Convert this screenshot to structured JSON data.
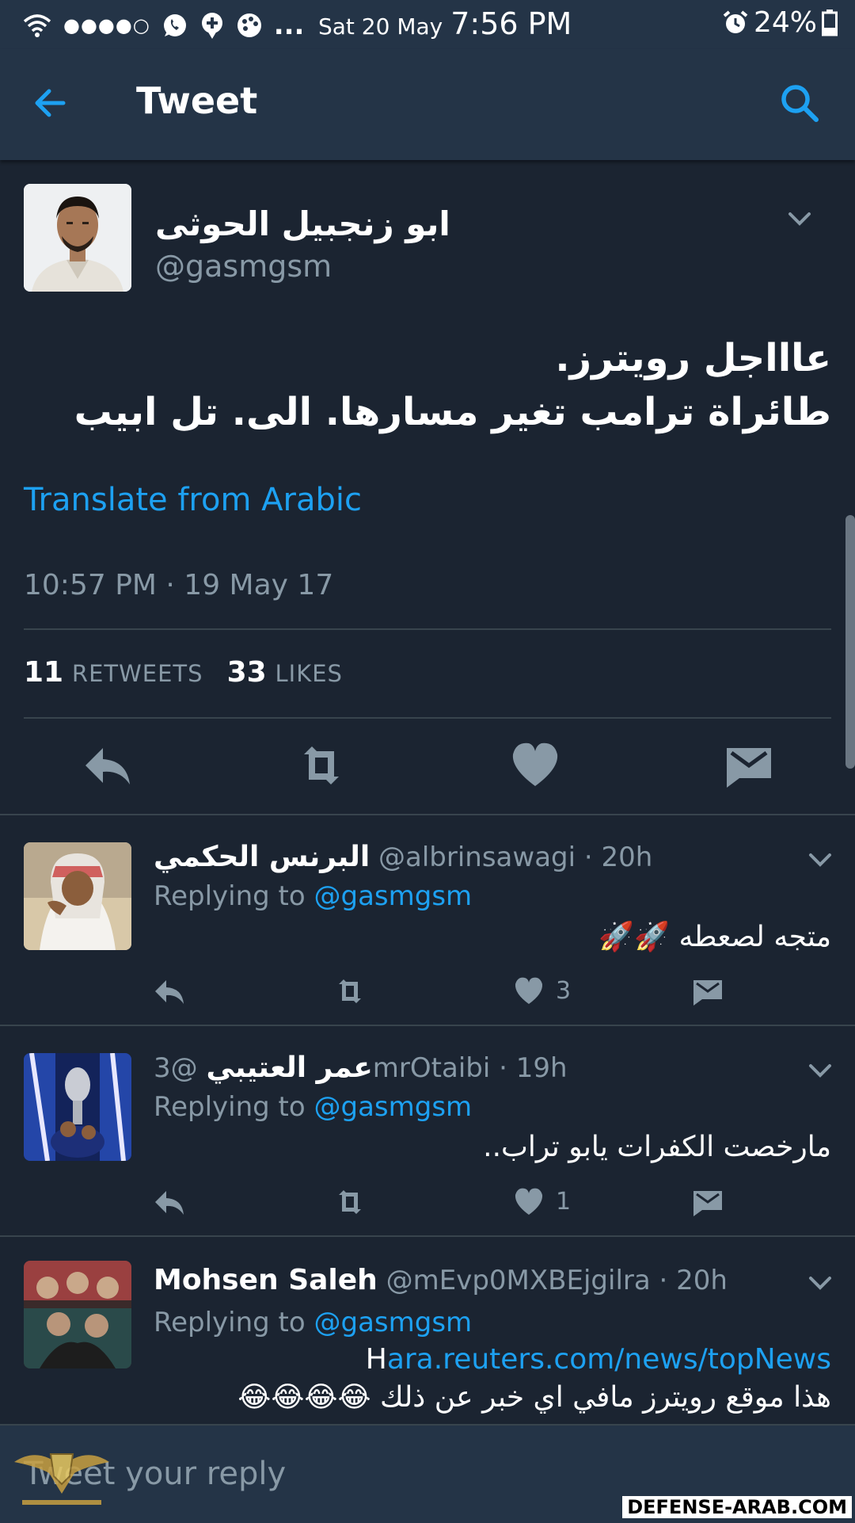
{
  "status_bar": {
    "dots": "●●●●○",
    "more": "...",
    "date": "Sat 20 May",
    "time": "7:56 PM",
    "battery": "24%"
  },
  "app_bar": {
    "title": "Tweet"
  },
  "tweet": {
    "author_name": "ابو زنجبيل الحوثى",
    "author_handle": "@gasmgsm",
    "text_line1": "عاااجل رويترز.",
    "text_line2": "طائراة ترامب تغير مسارها. الى. تل ابيب",
    "translate_label": "Translate from Arabic",
    "timestamp": "10:57 PM · 19 May 17",
    "retweets_count": "11",
    "retweets_label": "RETWEETS",
    "likes_count": "33",
    "likes_label": "LIKES"
  },
  "replies": [
    {
      "name": "البرنس الحكمي",
      "handle": "@albrinsawagi",
      "age": "· 20h",
      "replying_label": "Replying to",
      "replying_to": "@gasmgsm",
      "text": "متجه لصعطه 🚀🚀",
      "likes": "3"
    },
    {
      "name": "عمر العتيبي",
      "handle": "@3mrOtaibi",
      "age": "· 19h",
      "replying_label": "Replying to",
      "replying_to": "@gasmgsm",
      "text": "مارخصت الكفرات يابو تراب..",
      "likes": "1"
    },
    {
      "name": "Mohsen Saleh",
      "handle": "@mEvp0MXBEjgilra",
      "age": "· 20h",
      "replying_label": "Replying to",
      "replying_to": "@gasmgsm",
      "link": "ara.reuters.com/news/topNews",
      "link_suffix": "H",
      "text": "هذا موقع رويترز مافي اي خبر عن ذلك 😂😂😂😂"
    }
  ],
  "compose": {
    "placeholder": "Tweet your reply"
  },
  "watermark": {
    "site": "DEFENSE-ARAB.COM"
  },
  "colors": {
    "accent": "#1da1f2",
    "background": "#1b2431",
    "bar": "#243447",
    "muted": "#8899a6"
  }
}
